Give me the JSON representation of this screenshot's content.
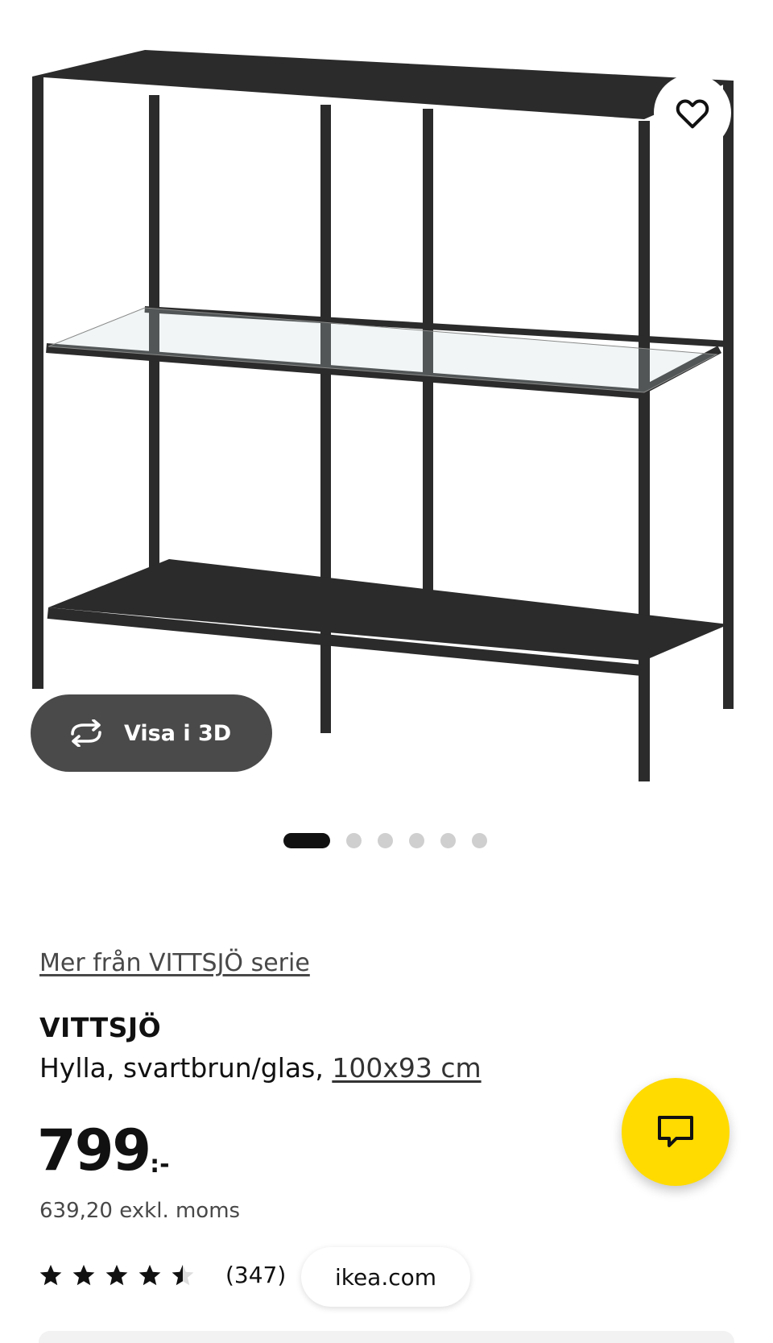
{
  "product_image": {
    "alt": "VITTSJÖ shelving unit",
    "favorite_icon": "heart-outline-icon",
    "view_3d": {
      "icon": "rotate-3d-icon",
      "label": "Visa i 3D"
    },
    "carousel": {
      "total": 6,
      "active_index": 0
    }
  },
  "product": {
    "series_link": "Mer från VITTSJÖ serie",
    "name": "VITTSJÖ",
    "description": "Hylla, svartbrun/glas,",
    "dimensions": "100x93 cm",
    "price": {
      "amount": "799",
      "suffix": ":-"
    },
    "price_ex_vat": "639,20 exkl. moms",
    "rating": {
      "value": 4.5,
      "max": 5,
      "count_label": "(347)"
    }
  },
  "browser": {
    "domain": "ikea.com"
  },
  "chat": {
    "icon": "chat-bubble-icon"
  },
  "colors": {
    "chat_button": "#ffdb00",
    "view3d_button": "#4a4a4a",
    "active_dot": "#111111",
    "inactive_dot": "#cfcfcf"
  }
}
